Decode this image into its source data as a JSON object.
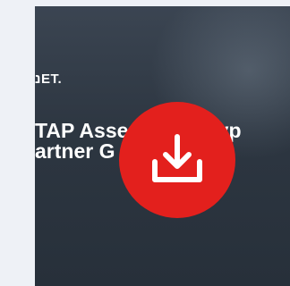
{
  "thumbnail": {
    "logo_text": "נET.",
    "title_line1": "TAP Assessment Typ",
    "title_line2": "artner G"
  },
  "download": {
    "icon": "download-icon",
    "color": "#e3201d"
  },
  "colors": {
    "page_bg": "#eef1f6",
    "thumb_bg": "#2d3641"
  }
}
